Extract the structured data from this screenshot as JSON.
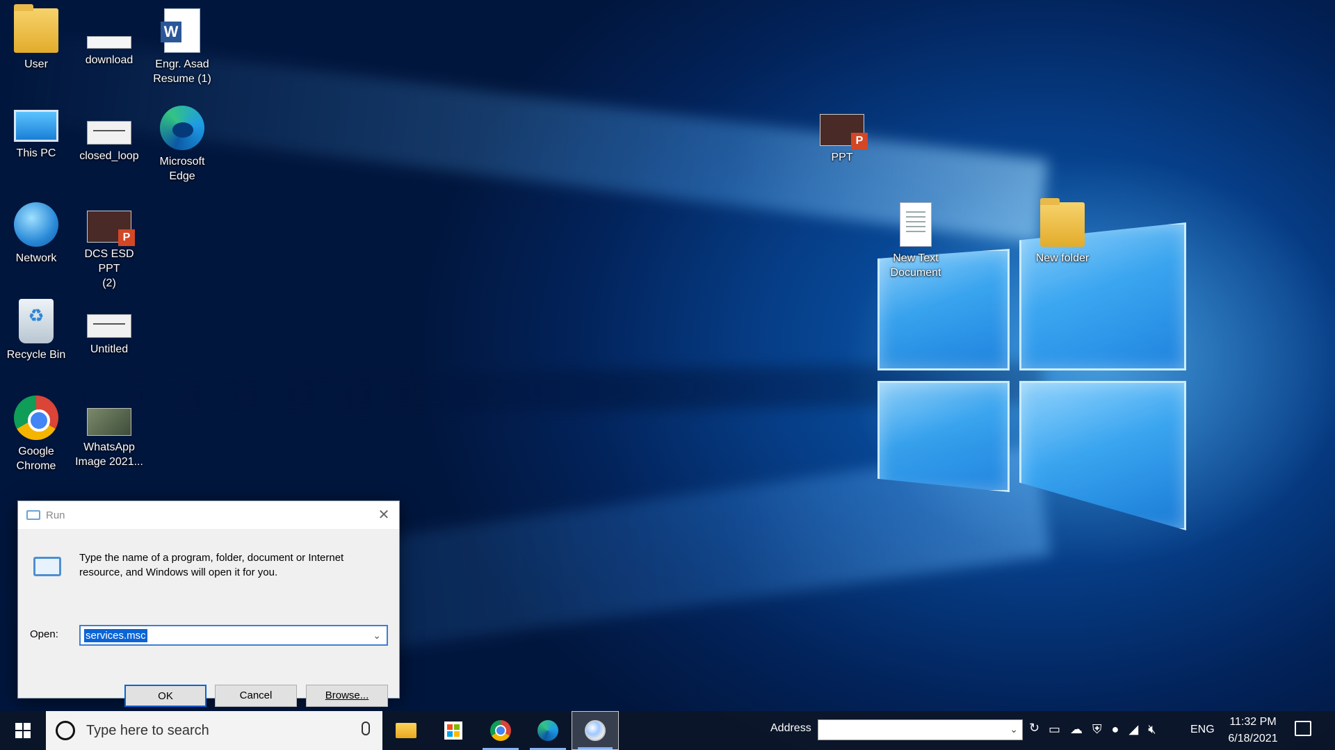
{
  "desktop": {
    "icons": {
      "user": "User",
      "download": "download",
      "resume": "Engr. Asad\nResume (1)",
      "this_pc": "This PC",
      "closed_loop": "closed_loop",
      "edge": "Microsoft\nEdge",
      "ppt": "PPT",
      "network": "Network",
      "dcs_esd": "DCS ESD PPT\n(2)",
      "new_text": "New Text\nDocument",
      "new_folder": "New folder",
      "recycle_bin": "Recycle Bin",
      "untitled": "Untitled",
      "chrome": "Google\nChrome",
      "whatsapp": "WhatsApp\nImage 2021..."
    }
  },
  "run_dialog": {
    "title": "Run",
    "description": "Type the name of a program, folder, document or Internet resource, and Windows will open it for you.",
    "open_label": "Open:",
    "open_value": "services.msc",
    "ok": "OK",
    "cancel": "Cancel",
    "browse": "Browse..."
  },
  "taskbar": {
    "search_placeholder": "Type here to search",
    "address_label": "Address",
    "address_value": "",
    "language": "ENG",
    "time": "11:32 PM",
    "date": "6/18/2021",
    "apps": [
      "file-explorer",
      "microsoft-store",
      "google-chrome",
      "microsoft-edge",
      "paint"
    ]
  },
  "colors": {
    "accent": "#0a64d6",
    "taskbar": "#0c1628",
    "desktop_blue": "#063d86"
  }
}
